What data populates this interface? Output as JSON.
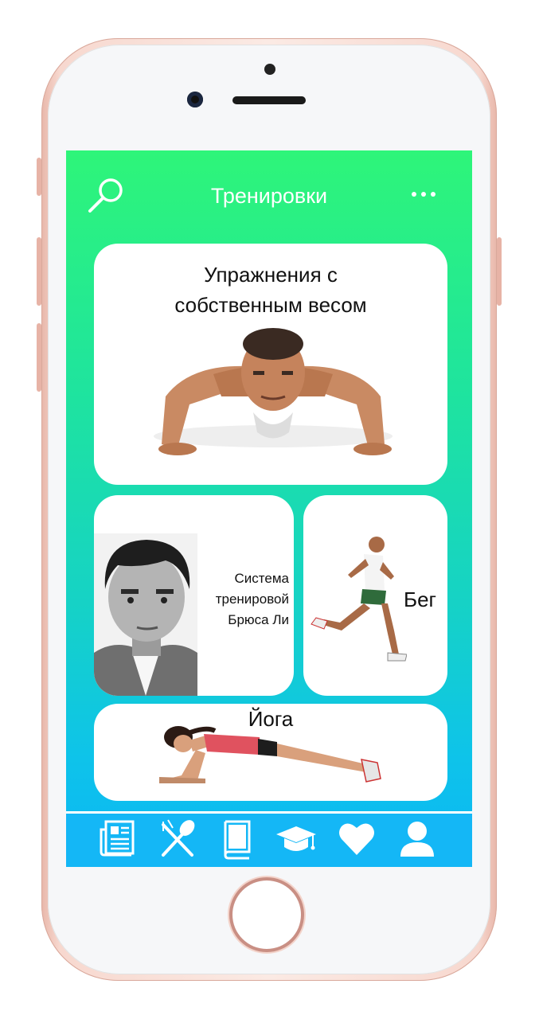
{
  "app": {
    "title": "Тренировки"
  },
  "header": {
    "search_icon": "search-icon",
    "more_icon": "more-dots-icon"
  },
  "cards": [
    {
      "title_line1": "Упражнения с",
      "title_line2": "собственным весом",
      "image": "pushup-man-photo"
    },
    {
      "title_line1": "Система",
      "title_line2": "тренировой",
      "title_line3": "Брюса Ли",
      "image": "bruce-lee-portrait"
    },
    {
      "title": "Бег",
      "image": "runner-photo"
    },
    {
      "title": "Йога",
      "image": "plank-woman-photo"
    }
  ],
  "tabbar": {
    "items": [
      {
        "icon": "newspaper-icon"
      },
      {
        "icon": "fork-spoon-icon"
      },
      {
        "icon": "book-icon"
      },
      {
        "icon": "graduation-cap-icon"
      },
      {
        "icon": "heart-icon"
      },
      {
        "icon": "user-icon"
      }
    ]
  },
  "colors": {
    "gradient_top": "#2ef579",
    "gradient_bottom": "#0bb6f5",
    "tabbar": "#14b7f6",
    "card": "#ffffff"
  }
}
